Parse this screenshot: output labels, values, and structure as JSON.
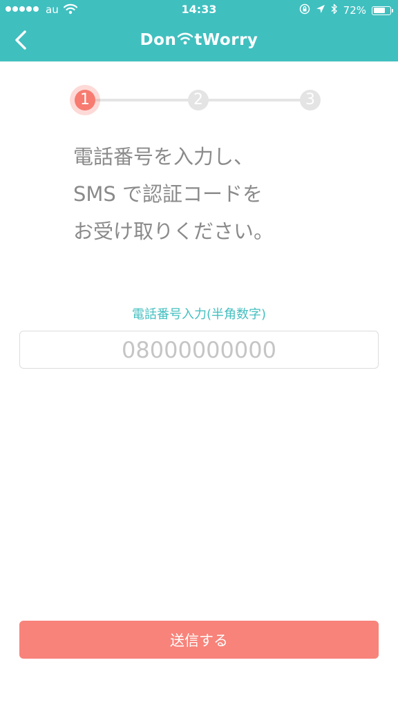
{
  "status_bar": {
    "carrier": "au",
    "time": "14:33",
    "battery_text": "72%",
    "battery_level": 0.72
  },
  "nav": {
    "logo_left": "Don",
    "logo_right": "tWorry",
    "logo_icon": "wifi-apostrophe-icon",
    "back_icon": "chevron-left-icon"
  },
  "stepper": {
    "steps": [
      "1",
      "2",
      "3"
    ],
    "current": 1
  },
  "instruction": {
    "lines": [
      "電話番号を入力し、",
      "SMS で認証コードを",
      "お受け取りください。"
    ]
  },
  "phone": {
    "label": "電話番号入力(半角数字)",
    "placeholder": "08000000000",
    "value": ""
  },
  "submit": {
    "label": "送信する"
  },
  "colors": {
    "header": "#40bfbf",
    "accent": "#f77b70",
    "label": "#45bfc0",
    "inactive_step": "#e4e4e4"
  }
}
